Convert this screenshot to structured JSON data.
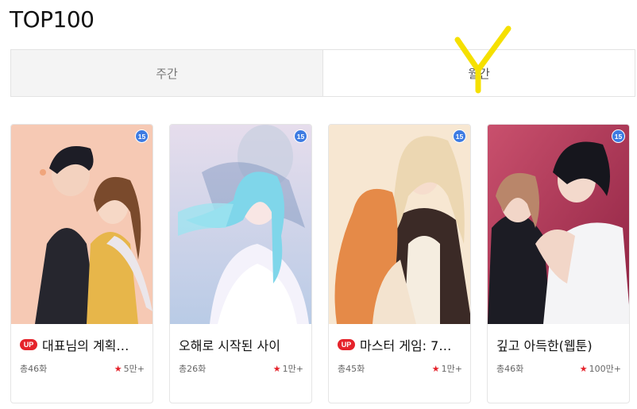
{
  "page": {
    "title": "TOP100"
  },
  "tabs": [
    {
      "label": "주간",
      "active": false
    },
    {
      "label": "월간",
      "active": true
    }
  ],
  "annotation": {
    "mark": "Y",
    "color": "#f5e000"
  },
  "cards": [
    {
      "title": "대표님의 계획…",
      "up": true,
      "up_label": "UP",
      "age": "15",
      "episodes": "총46화",
      "views": "5만+",
      "palette": [
        "#f6c9b4",
        "#f0b7a0",
        "#2a2a33",
        "#e7b64a"
      ]
    },
    {
      "title": "오해로 시작된 사이",
      "up": false,
      "up_label": "",
      "age": "15",
      "episodes": "총26화",
      "views": "1만+",
      "palette": [
        "#e6ddec",
        "#c9d6ea",
        "#7fd6ea",
        "#f4f2fb"
      ]
    },
    {
      "title": "마스터 게임: 7…",
      "up": true,
      "up_label": "UP",
      "age": "15",
      "episodes": "총45화",
      "views": "1만+",
      "palette": [
        "#f7e7d2",
        "#ecd7b2",
        "#e58a48",
        "#3b2a26"
      ]
    },
    {
      "title": "깊고 아득한(웹툰)",
      "up": false,
      "up_label": "",
      "age": "15",
      "episodes": "총46화",
      "views": "100만+",
      "palette": [
        "#c9506d",
        "#9d2a48",
        "#1c1c24",
        "#f2d6c8"
      ]
    }
  ],
  "colors": {
    "accent_red": "#e5232b",
    "age_badge_blue": "#3d7be2",
    "tab_inactive_bg": "#f4f4f4"
  }
}
